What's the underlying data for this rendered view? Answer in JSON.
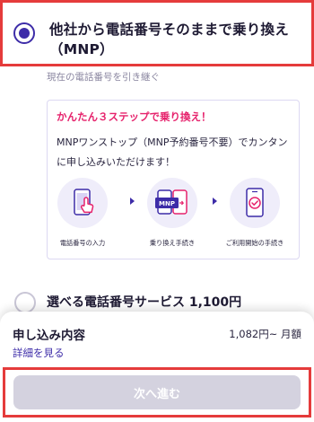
{
  "option_mnp": {
    "title": "他社から電話番号そのままで乗り換え（MNP）",
    "subtitle": "現在の電話番号を引き継ぐ",
    "selected": true
  },
  "steps_card": {
    "heading": "かんたん３ステップで乗り換え！",
    "description": "MNPワンストップ（MNP予約番号不要）でカンタンに申し込みいただけます！",
    "steps": [
      {
        "icon": "phone-tap-icon",
        "label": "電話番号の入力"
      },
      {
        "icon": "mnp-transfer-icon",
        "label": "乗り換え手続き",
        "badge": "MNP"
      },
      {
        "icon": "phone-check-icon",
        "label": "ご利用開始の手続き"
      }
    ]
  },
  "option_number_service": {
    "label": "選べる電話番号サービス 1,100円",
    "selected": false
  },
  "summary_sheet": {
    "title": "申し込み内容",
    "price": "1,082円~ 月額",
    "details_link": "詳細を見る",
    "next_button": "次へ進む"
  },
  "colors": {
    "accent": "#3d2ca8",
    "highlight_red": "#e53b3b",
    "pink": "#e6226c",
    "disabled_button": "#d4d2df"
  }
}
